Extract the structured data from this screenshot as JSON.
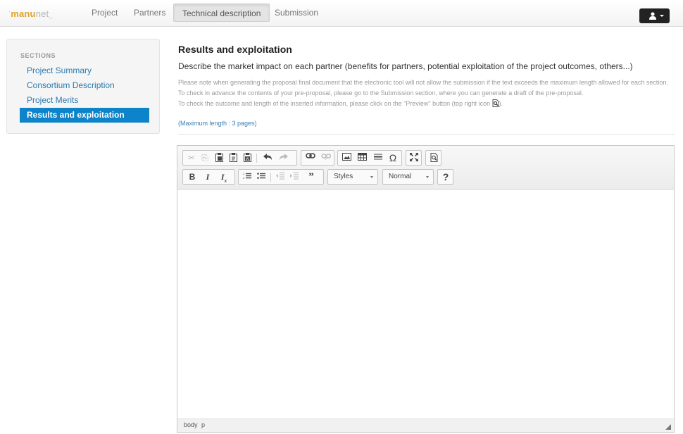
{
  "navbar": {
    "logo": {
      "prefix": "manu",
      "suffix": "net",
      "dot": "·",
      "tail": "_"
    },
    "items": [
      {
        "label": "Project",
        "active": false
      },
      {
        "label": "Partners",
        "active": false
      },
      {
        "label": "Technical description",
        "active": true
      },
      {
        "label": "Submission",
        "active": false
      }
    ],
    "user_menu": {
      "icon": "user-icon",
      "caret": "caret-down-icon"
    }
  },
  "sidebar": {
    "header": "SECTIONS",
    "items": [
      {
        "label": "Project Summary",
        "active": false
      },
      {
        "label": "Consortium Description",
        "active": false
      },
      {
        "label": "Project Merits",
        "active": false
      },
      {
        "label": "Results and exploitation",
        "active": true
      }
    ],
    "active_color": "#0d83c9",
    "link_color": "#2a7ab0"
  },
  "main": {
    "title": "Results and exploitation",
    "subtitle": "Describe the market impact on each partner (benefits for partners, potential exploitation of the project outcomes, others...)",
    "note_line1": "Please note when generating the proposal final document that the electronic tool will not allow the submission if the text exceeds the maximum length allowed for each section. To check in advance the contents of your pre-proposal, please go to the Submission section, where you can generate a draft of the pre-proposal.",
    "note_line2_before": "To check the outcome and length of the inserted information, please click on the \"Preview\" button (top right icon",
    "note_line2_after": ").",
    "max_length": "(Maximum length : 3 pages)"
  },
  "editor": {
    "toolbar_row1": [
      [
        "cut-icon",
        "copy-icon",
        "paste-icon",
        "paste-text-icon",
        "paste-word-icon",
        "undo-icon",
        "redo-icon"
      ],
      [
        "link-icon",
        "unlink-icon"
      ],
      [
        "image-icon",
        "table-icon",
        "horizontal-rule-icon",
        "special-char-icon"
      ],
      [
        "maximize-icon"
      ],
      [
        "preview-icon"
      ]
    ],
    "toolbar_row2": [
      [
        "bold-icon",
        "italic-icon",
        "remove-format-icon"
      ],
      [
        "numbered-list-icon",
        "bulleted-list-icon",
        "outdent-icon",
        "indent-icon",
        "blockquote-icon"
      ]
    ],
    "styles_combo": "Styles",
    "format_combo": "Normal",
    "help_label": "?",
    "statusbar_path": [
      "body",
      "p"
    ],
    "content": ""
  }
}
